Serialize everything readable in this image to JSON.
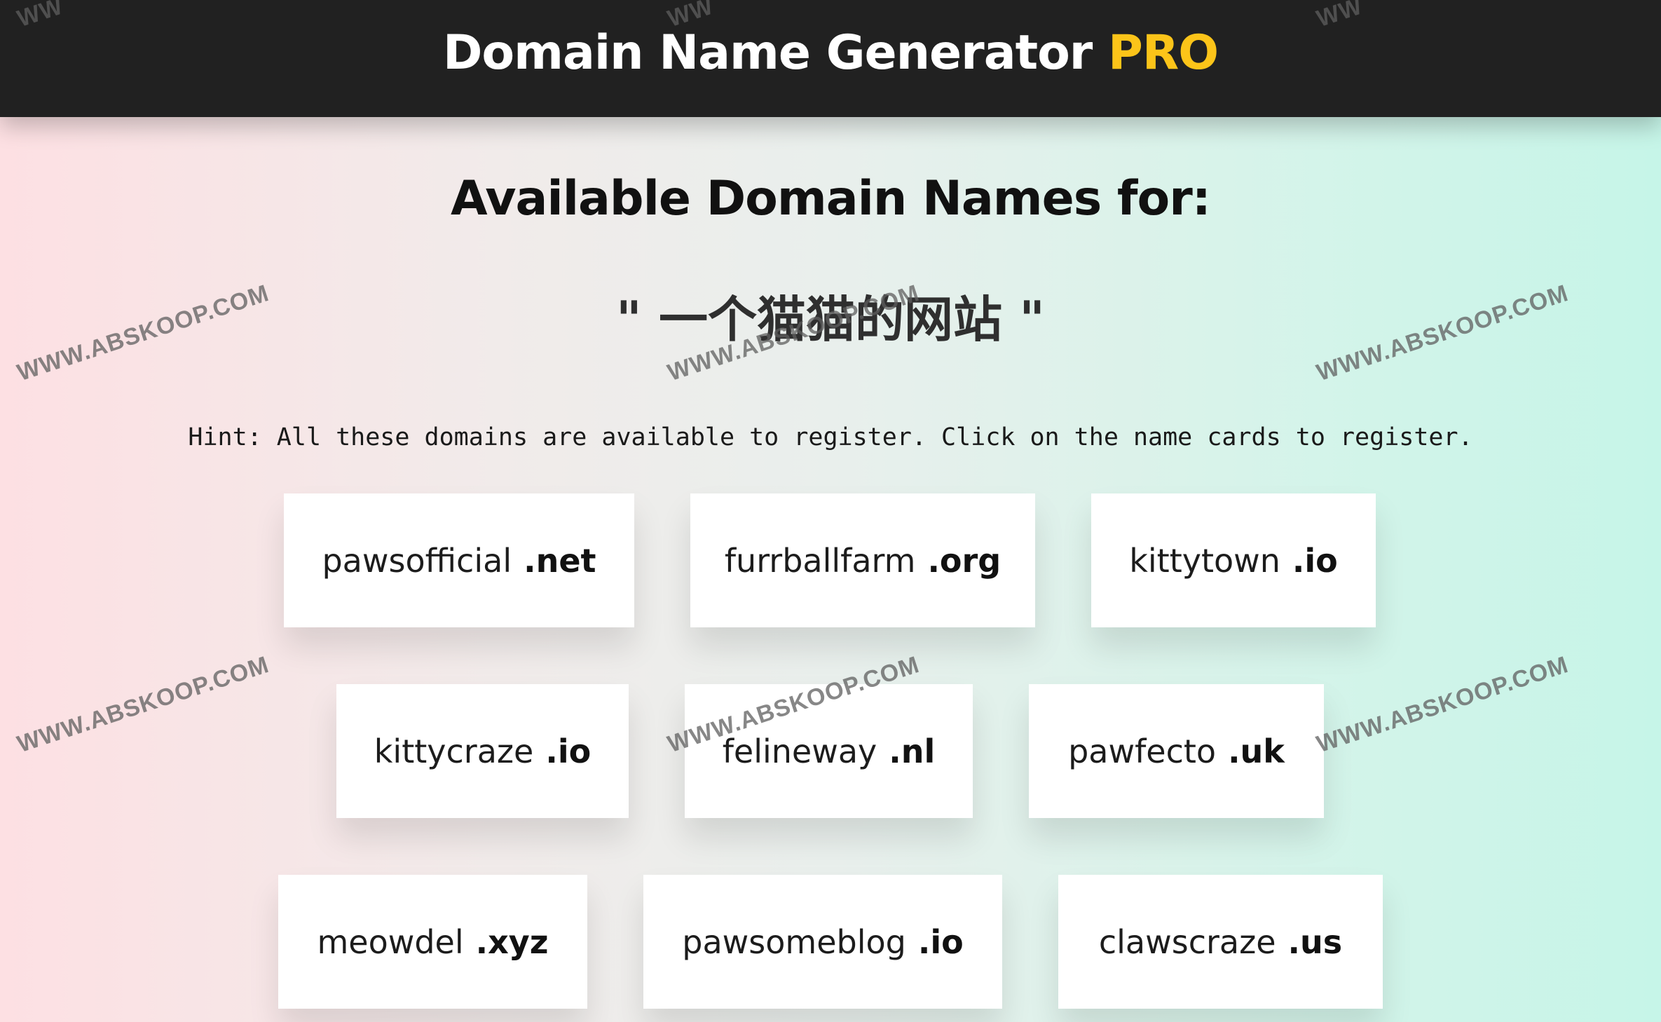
{
  "header": {
    "title_main": "Domain Name Generator",
    "title_accent": "PRO"
  },
  "heading": "Available Domain Names for:",
  "query": "\" 一个猫猫的网站 \"",
  "hint": "Hint: All these domains are available to register. Click on the name cards to register.",
  "domains": [
    {
      "name": "pawsofficial",
      "tld": ".net"
    },
    {
      "name": "furrballfarm",
      "tld": ".org"
    },
    {
      "name": "kittytown",
      "tld": ".io"
    },
    {
      "name": "kittycraze",
      "tld": ".io"
    },
    {
      "name": "felineway",
      "tld": ".nl"
    },
    {
      "name": "pawfecto",
      "tld": ".uk"
    },
    {
      "name": "meowdel",
      "tld": ".xyz"
    },
    {
      "name": "pawsomeblog",
      "tld": ".io"
    },
    {
      "name": "clawscraze",
      "tld": ".us"
    }
  ],
  "watermark": {
    "text": "WWW.ABSKOOP.COM",
    "fragment": "WW"
  },
  "colors": {
    "header_bg": "#212121",
    "accent": "#fcc419",
    "gradient_left": "#fde0e3",
    "gradient_right": "#c6f5e8"
  }
}
